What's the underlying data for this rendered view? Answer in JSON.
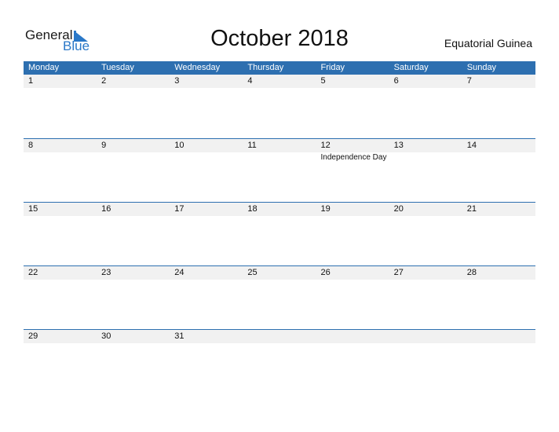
{
  "logo": {
    "general": "General",
    "blue": "Blue"
  },
  "title": "October 2018",
  "country": "Equatorial Guinea",
  "accent_color": "#2d6fb0",
  "weekdays": [
    "Monday",
    "Tuesday",
    "Wednesday",
    "Thursday",
    "Friday",
    "Saturday",
    "Sunday"
  ],
  "weeks": [
    {
      "days": [
        "1",
        "2",
        "3",
        "4",
        "5",
        "6",
        "7"
      ],
      "events": [
        "",
        "",
        "",
        "",
        "",
        "",
        ""
      ]
    },
    {
      "days": [
        "8",
        "9",
        "10",
        "11",
        "12",
        "13",
        "14"
      ],
      "events": [
        "",
        "",
        "",
        "",
        "Independence Day",
        "",
        ""
      ]
    },
    {
      "days": [
        "15",
        "16",
        "17",
        "18",
        "19",
        "20",
        "21"
      ],
      "events": [
        "",
        "",
        "",
        "",
        "",
        "",
        ""
      ]
    },
    {
      "days": [
        "22",
        "23",
        "24",
        "25",
        "26",
        "27",
        "28"
      ],
      "events": [
        "",
        "",
        "",
        "",
        "",
        "",
        ""
      ]
    },
    {
      "days": [
        "29",
        "30",
        "31",
        "",
        "",
        "",
        ""
      ],
      "events": [
        "",
        "",
        "",
        "",
        "",
        "",
        ""
      ]
    }
  ]
}
